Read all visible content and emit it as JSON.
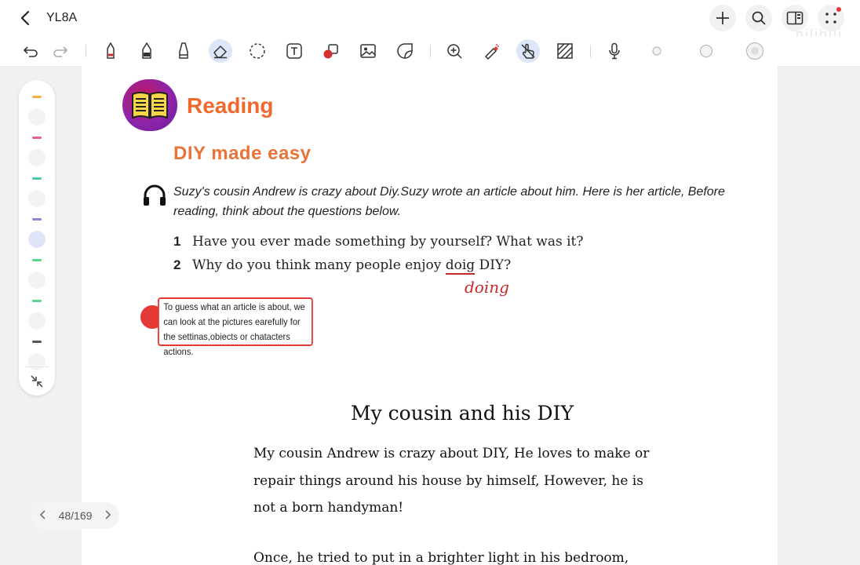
{
  "app": {
    "title": "YL8A"
  },
  "watermark": "bilibili",
  "toolbar": {
    "tools": [
      "undo-icon",
      "redo-icon",
      "pen-icon",
      "fountain-pen-icon",
      "highlighter-icon",
      "eraser-icon",
      "lasso-icon",
      "text-box-icon",
      "shape-icon",
      "image-icon",
      "sticker-icon",
      "zoom-icon",
      "laser-pointer-icon",
      "hand-touch-icon",
      "hatch-icon",
      "microphone-icon",
      "dot-small-icon",
      "dot-medium-icon",
      "dot-large-icon"
    ]
  },
  "palette": {
    "colors": [
      "#f5b041",
      "#ec5f9c",
      "#48c9b0",
      "#9b7fd4",
      "#58d68d",
      "#58d68d",
      "#555555"
    ]
  },
  "page": {
    "section": "Reading",
    "title": "DIY made easy",
    "intro": "Suzy's cousin Andrew is crazy about Diy.Suzy wrote an article about him. Here is her article, Before reading, think about the questions below.",
    "questions": [
      {
        "num": "1",
        "text": "Have you ever made something by yourself? What was it?"
      },
      {
        "num": "2",
        "text_before": "Why do you think many people enjoy ",
        "text_marked": "doig",
        "text_after": " DIY?"
      }
    ],
    "annotation": "doing",
    "tip": "To guess what an article is about, we can look at the pictures earefully for the settinas,obiects or chatacters actions.",
    "story_title": "My cousin and his DIY",
    "story_lines": [
      "My cousin Andrew is crazy about DIY, He loves to make or",
      "repair things around his house by himself, However, he is",
      "not a born handyman!",
      "Once, he tried to put in a brighter light in his bedroom,"
    ]
  },
  "pagenav": {
    "label": "48/169"
  },
  "colors": {
    "accent": "#f0682c",
    "ink": "#c62828",
    "active_tool": "#dce6f7"
  }
}
